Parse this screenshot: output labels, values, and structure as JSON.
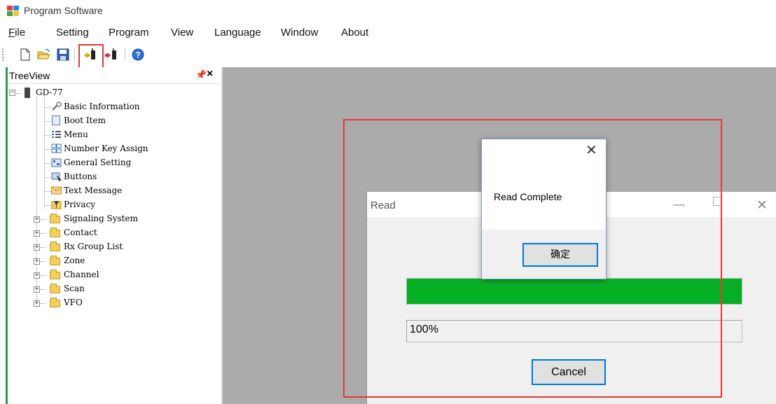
{
  "app": {
    "title": "Program Software",
    "icon": "program-software-icon"
  },
  "menu": [
    {
      "label": "File",
      "mnemonic": "F"
    },
    {
      "label": "Setting"
    },
    {
      "label": "Program"
    },
    {
      "label": "View"
    },
    {
      "label": "Language"
    },
    {
      "label": "Window"
    },
    {
      "label": "About"
    }
  ],
  "toolbar": {
    "buttons": [
      "new-file-icon",
      "open-folder-icon",
      "save-icon",
      "read-from-radio-icon",
      "write-to-radio-icon",
      "help-icon"
    ],
    "highlighted": "read-from-radio-icon",
    "highlight_color": "#e53935"
  },
  "treeview": {
    "title": "TreeView",
    "pin_glyph": " ",
    "close_glyph": "×",
    "root": "GD-77",
    "items": [
      {
        "label": "Basic Information",
        "icon": "wrench-icon",
        "expandable": false
      },
      {
        "label": "Boot Item",
        "icon": "document-icon",
        "expandable": false
      },
      {
        "label": "Menu",
        "icon": "list-icon",
        "expandable": false
      },
      {
        "label": "Number Key Assign",
        "icon": "keypad-icon",
        "expandable": false
      },
      {
        "label": "General Setting",
        "icon": "settings-icon",
        "expandable": false
      },
      {
        "label": "Buttons",
        "icon": "buttons-icon",
        "expandable": false
      },
      {
        "label": "Text Message",
        "icon": "envelope-icon",
        "expandable": false
      },
      {
        "label": "Privacy",
        "icon": "privacy-icon",
        "expandable": false
      },
      {
        "label": "Signaling System",
        "icon": "folder-icon",
        "expandable": true
      },
      {
        "label": "Contact",
        "icon": "folder-icon",
        "expandable": true
      },
      {
        "label": "Rx Group List",
        "icon": "folder-icon",
        "expandable": true
      },
      {
        "label": "Zone",
        "icon": "folder-icon",
        "expandable": true
      },
      {
        "label": "Channel",
        "icon": "folder-icon",
        "expandable": true
      },
      {
        "label": "Scan",
        "icon": "folder-icon",
        "expandable": true
      },
      {
        "label": "VFO",
        "icon": "folder-icon",
        "expandable": true
      }
    ]
  },
  "read_dialog": {
    "title": "Read",
    "progress": 1.0,
    "progress_text": "100%",
    "cancel_label": "Cancel",
    "progress_color": "#06b025"
  },
  "message_box": {
    "text": "Read Complete",
    "ok_label": "确定"
  },
  "colors": {
    "mdi_background": "#ababab",
    "accent_border": "#0078d7",
    "annotation_red": "#e53935"
  }
}
